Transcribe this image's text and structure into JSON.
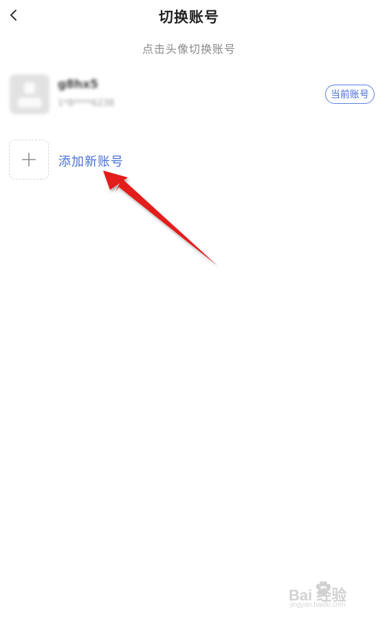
{
  "header": {
    "back_icon": "chevron-left-icon",
    "title": "切换账号"
  },
  "hint": "点击头像切换账号",
  "current_account": {
    "name": "g8hx5",
    "phone": "1*8****6238",
    "badge": "当前账号"
  },
  "add_account": {
    "icon": "plus-icon",
    "label": "添加新账号"
  },
  "annotation": {
    "color": "#e31b1b"
  },
  "watermark": {
    "text": "Bai 经验",
    "sub": "jingyan.baidu.com"
  },
  "colors": {
    "accent": "#4a6fd6",
    "hint": "#8a8a8a"
  }
}
